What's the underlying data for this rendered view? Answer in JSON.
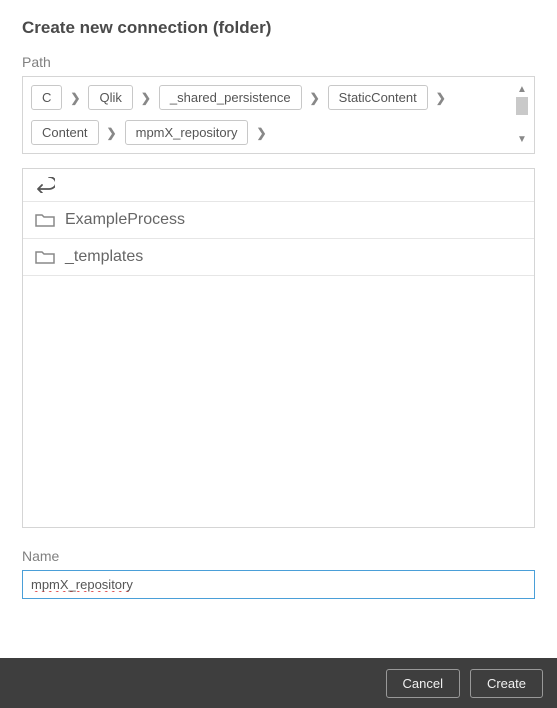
{
  "title": "Create new connection (folder)",
  "path_label": "Path",
  "path": [
    "C",
    "Qlik",
    "_shared_persistence",
    "StaticContent",
    "Content",
    "mpmX_repository"
  ],
  "folders": [
    "ExampleProcess",
    "_templates"
  ],
  "name_label": "Name",
  "name_value": "mpmX_repository",
  "buttons": {
    "cancel": "Cancel",
    "create": "Create"
  }
}
